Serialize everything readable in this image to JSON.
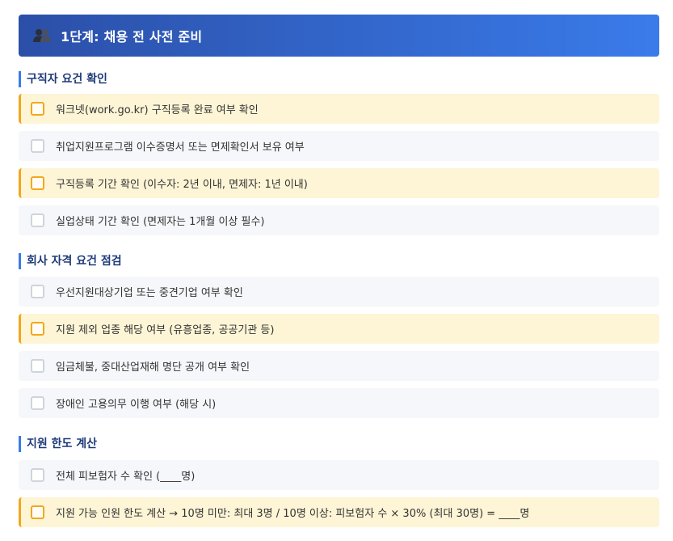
{
  "header": {
    "title": "1단계: 채용 전 사전 준비",
    "icon": "people-icon"
  },
  "sections": [
    {
      "title": "구직자 요건 확인",
      "items": [
        {
          "label": "워크넷(work.go.kr) 구직등록 완료 여부 확인",
          "highlight": true,
          "checked": false
        },
        {
          "label": "취업지원프로그램 이수증명서 또는 면제확인서 보유 여부",
          "highlight": false,
          "checked": false
        },
        {
          "label": "구직등록 기간 확인 (이수자: 2년 이내, 면제자: 1년 이내)",
          "highlight": true,
          "checked": false
        },
        {
          "label": "실업상태 기간 확인 (면제자는 1개월 이상 필수)",
          "highlight": false,
          "checked": false
        }
      ]
    },
    {
      "title": "회사 자격 요건 점검",
      "items": [
        {
          "label": "우선지원대상기업 또는 중견기업 여부 확인",
          "highlight": false,
          "checked": false
        },
        {
          "label": "지원 제외 업종 해당 여부 (유흥업종, 공공기관 등)",
          "highlight": true,
          "checked": false
        },
        {
          "label": "임금체불, 중대산업재해 명단 공개 여부 확인",
          "highlight": false,
          "checked": false
        },
        {
          "label": "장애인 고용의무 이행 여부 (해당 시)",
          "highlight": false,
          "checked": false
        }
      ]
    },
    {
      "title": "지원 한도 계산",
      "items": [
        {
          "label": "전체 피보험자 수 확인 (____명)",
          "highlight": false,
          "checked": false
        },
        {
          "label": "지원 가능 인원 한도 계산 → 10명 미만: 최대 3명 / 10명 이상: 피보험자 수 × 30% (최대 30명) = ____명",
          "highlight": true,
          "checked": false
        }
      ]
    }
  ],
  "colors": {
    "header_start": "#2b4fa8",
    "header_end": "#3a7bea",
    "accent": "#3a7bea",
    "highlight_bg": "#fdf5d6",
    "highlight_border": "#f2a81b",
    "normal_bg": "#f5f7fa"
  }
}
